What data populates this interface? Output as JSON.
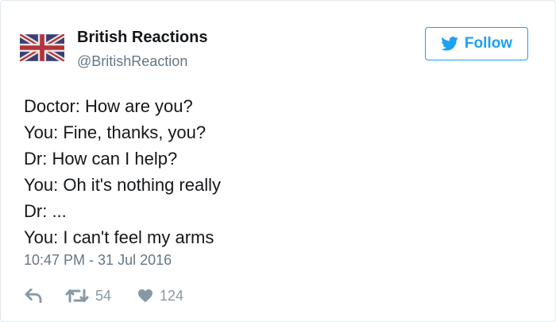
{
  "tweet": {
    "author": {
      "display_name": "British Reactions",
      "handle": "@BritishReaction",
      "avatar_icon": "union-jack-flag-icon"
    },
    "follow_button": {
      "label": "Follow",
      "icon": "twitter-bird-icon"
    },
    "lines": [
      "Doctor: How are you?",
      "You: Fine, thanks, you?",
      "Dr: How can I help?",
      "You: Oh it's nothing really",
      "Dr: ...",
      "You: I can't feel my arms"
    ],
    "timestamp": "10:47 PM - 31 Jul 2016",
    "actions": {
      "reply": {
        "icon": "reply-icon"
      },
      "retweet": {
        "icon": "retweet-icon",
        "count": "54"
      },
      "like": {
        "icon": "heart-icon",
        "count": "124"
      }
    }
  },
  "colors": {
    "accent": "#1da1f2",
    "secondary_text": "#657786",
    "icon_gray": "#8899a6",
    "border": "#e1e8ed"
  }
}
